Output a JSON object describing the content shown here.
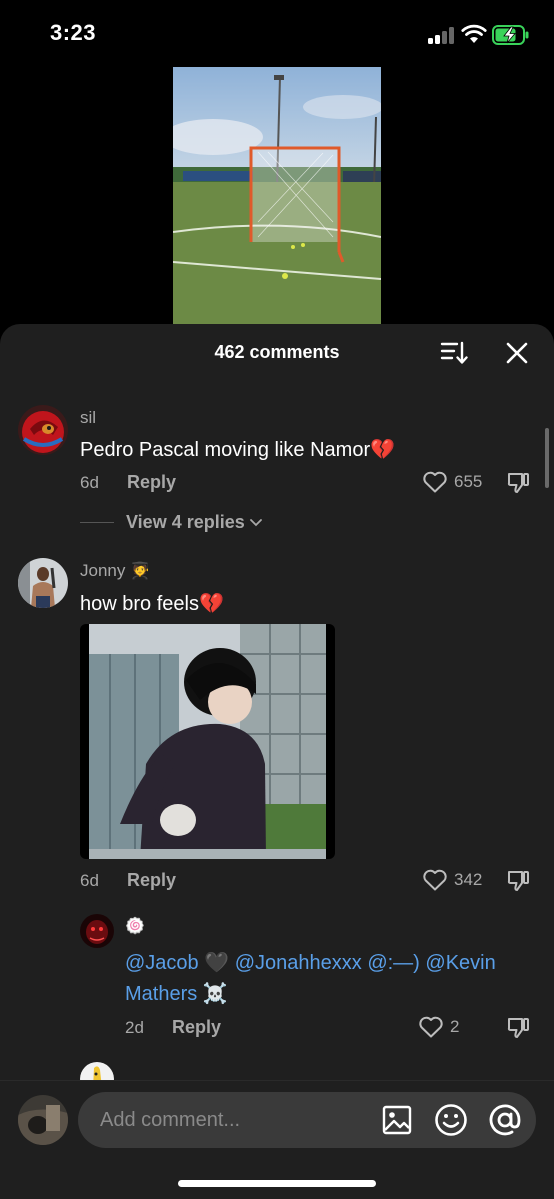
{
  "status_bar": {
    "time": "3:23"
  },
  "sheet": {
    "title": "462 comments"
  },
  "comments": [
    {
      "username": "sil",
      "text": "Pedro Pascal moving like Namor",
      "emoji": "💔",
      "time": "6d",
      "reply_label": "Reply",
      "likes": "655",
      "view_replies": "View 4 replies"
    },
    {
      "username": "Jonny",
      "user_emoji": "🧑‍🎓",
      "text": "how bro feels",
      "emoji": "💔",
      "time": "6d",
      "reply_label": "Reply",
      "likes": "342"
    }
  ],
  "reply": {
    "username_emoji": "🍥",
    "mention1": "@Jacob",
    "heart": "🖤",
    "mention2": "@Jonahhexxx",
    "mention3": "@:—)",
    "mention4a": "@Kevin",
    "mention4b": "Mathers",
    "skull": "☠️",
    "time": "2d",
    "reply_label": "Reply",
    "likes": "2"
  },
  "input": {
    "placeholder": "Add comment..."
  },
  "icons": [
    "sort-icon",
    "close-icon",
    "heart-icon",
    "dislike-icon",
    "image-icon",
    "emoji-icon",
    "mention-icon",
    "chevron-down-icon"
  ],
  "colors": {
    "mention": "#5a9fe8",
    "sheet_bg": "#1f1f1f",
    "secondary_text": "#a8a8a8"
  }
}
